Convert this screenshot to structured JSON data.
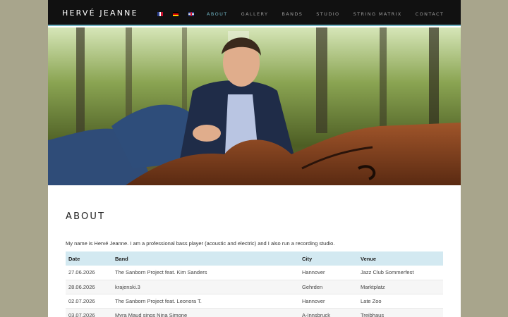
{
  "brand": "HERVÉ JEANNE",
  "nav": {
    "flags": [
      "flag-fr-icon",
      "flag-de-icon",
      "flag-uk-icon"
    ],
    "items": [
      "ABOUT",
      "GALLERY",
      "BANDS",
      "STUDIO",
      "STRING MATRIX",
      "CONTACT"
    ],
    "active": "ABOUT"
  },
  "colors": {
    "accent": "#6fb3c2",
    "header_bg": "#111111",
    "table_header": "#d3e9f1",
    "outer_bg": "#a8a58c"
  },
  "about": {
    "title": "ABOUT",
    "intro": "My name is Hervé Jeanne. I am a professional bass player (acoustic and electric) and I also run a recording studio."
  },
  "table": {
    "headers": [
      "Date",
      "Band",
      "City",
      "Venue"
    ],
    "rows": [
      [
        "27.06.2026",
        "The Sanborn Project feat. Kim Sanders",
        "Hannover",
        "Jazz Club Sommerfest"
      ],
      [
        "28.06.2026",
        "krajenski.3",
        "Gehrden",
        "Marktplatz"
      ],
      [
        "02.07.2026",
        "The Sanborn Project feat. Leonora T.",
        "Hannover",
        "Late Zoo"
      ],
      [
        "03.07.2026",
        "Myra Maud sings Nina Simone",
        "A-Innsbruck",
        "Treibhaus"
      ]
    ]
  }
}
